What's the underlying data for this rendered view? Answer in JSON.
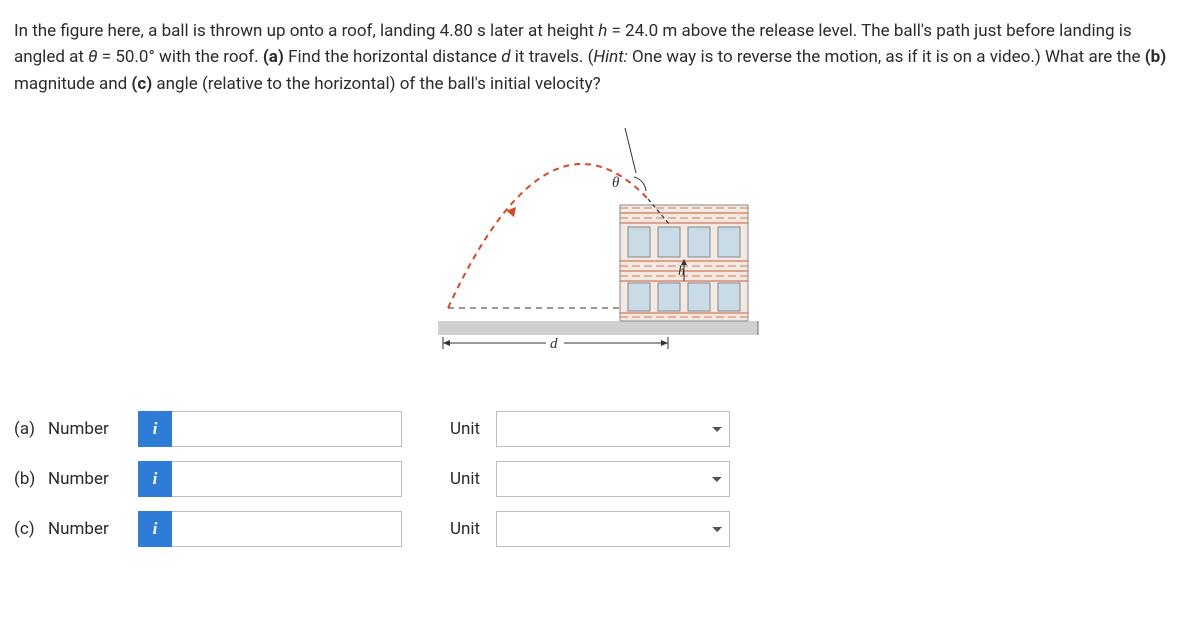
{
  "problem": {
    "t1": "In the figure here, a ball is thrown up onto a roof, landing 4.80 s later at height ",
    "var_h": "h",
    "t2": " = 24.0 m above the release level. The ball's path just before landing is angled at ",
    "var_theta": "θ",
    "t3": " = 50.0° with the roof. ",
    "part_a_label": "(a)",
    "t4": " Find the horizontal distance ",
    "var_d": "d",
    "t5": " it travels. (",
    "hint_label": "Hint:",
    "t6": " One way is to reverse the motion, as if it is on a video.) What are the ",
    "part_b_label": "(b)",
    "t7": " magnitude and ",
    "part_c_label": "(c)",
    "t8": " angle (relative to the horizontal) of the ball's initial velocity?"
  },
  "figure": {
    "theta_label": "θ",
    "h_label": "h",
    "d_label": "d"
  },
  "answers": {
    "info_glyph": "i",
    "number_label": "Number",
    "unit_label": "Unit",
    "rows": [
      {
        "part": "(a)"
      },
      {
        "part": "(b)"
      },
      {
        "part": "(c)"
      }
    ]
  }
}
